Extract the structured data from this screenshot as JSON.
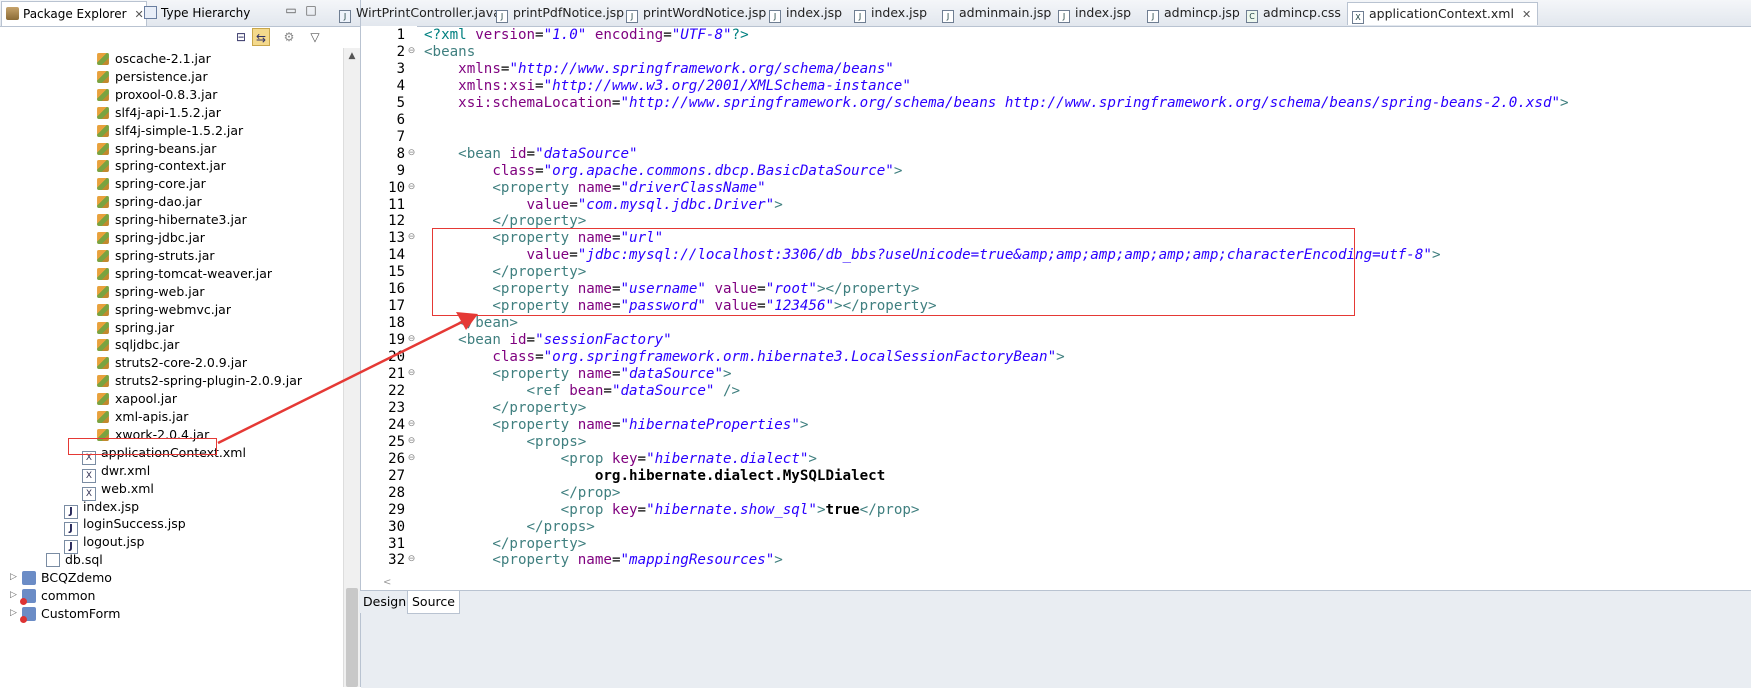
{
  "left_panel": {
    "tabs": [
      {
        "label": "Package Explorer",
        "close": "✕"
      },
      {
        "label": "Type Hierarchy"
      }
    ],
    "tree_items": [
      {
        "label": "oscache-2.1.jar",
        "icon": "jar-icon"
      },
      {
        "label": "persistence.jar",
        "icon": "jar-icon"
      },
      {
        "label": "proxool-0.8.3.jar",
        "icon": "jar-icon"
      },
      {
        "label": "slf4j-api-1.5.2.jar",
        "icon": "jar-icon"
      },
      {
        "label": "slf4j-simple-1.5.2.jar",
        "icon": "jar-icon"
      },
      {
        "label": "spring-beans.jar",
        "icon": "jar-icon"
      },
      {
        "label": "spring-context.jar",
        "icon": "jar-icon"
      },
      {
        "label": "spring-core.jar",
        "icon": "jar-icon"
      },
      {
        "label": "spring-dao.jar",
        "icon": "jar-icon"
      },
      {
        "label": "spring-hibernate3.jar",
        "icon": "jar-icon"
      },
      {
        "label": "spring-jdbc.jar",
        "icon": "jar-icon"
      },
      {
        "label": "spring-struts.jar",
        "icon": "jar-icon"
      },
      {
        "label": "spring-tomcat-weaver.jar",
        "icon": "jar-icon"
      },
      {
        "label": "spring-web.jar",
        "icon": "jar-icon"
      },
      {
        "label": "spring-webmvc.jar",
        "icon": "jar-icon"
      },
      {
        "label": "spring.jar",
        "icon": "jar-icon"
      },
      {
        "label": "sqljdbc.jar",
        "icon": "jar-icon"
      },
      {
        "label": "struts2-core-2.0.9.jar",
        "icon": "jar-icon"
      },
      {
        "label": "struts2-spring-plugin-2.0.9.jar",
        "icon": "jar-icon"
      },
      {
        "label": "xapool.jar",
        "icon": "jar-icon"
      },
      {
        "label": "xml-apis.jar",
        "icon": "jar-icon"
      },
      {
        "label": "xwork-2.0.4.jar",
        "icon": "jar-icon"
      },
      {
        "label": "applicationContext.xml",
        "icon": "xml-file-icon"
      },
      {
        "label": "dwr.xml",
        "icon": "xml-file-icon"
      },
      {
        "label": "web.xml",
        "icon": "xml-file-icon"
      },
      {
        "label": "index.jsp",
        "icon": "jsp-file-icon"
      },
      {
        "label": "loginSuccess.jsp",
        "icon": "jsp-file-icon"
      },
      {
        "label": "logout.jsp",
        "icon": "jsp-file-icon"
      },
      {
        "label": "db.sql",
        "icon": "sql-file-icon"
      },
      {
        "label": "BCQZdemo",
        "icon": "project-icon"
      },
      {
        "label": "common",
        "icon": "project-error-icon"
      },
      {
        "label": "CustomForm",
        "icon": "project-error-icon"
      }
    ]
  },
  "editor": {
    "tabs": [
      {
        "label": "WirtPrintController.java",
        "icon": "java-file-icon"
      },
      {
        "label": "printPdfNotice.jsp",
        "icon": "jsp-file-icon"
      },
      {
        "label": "printWordNotice.jsp",
        "icon": "jsp-file-icon"
      },
      {
        "label": "index.jsp",
        "icon": "jsp-file-icon"
      },
      {
        "label": "index.jsp",
        "icon": "jsp-file-icon"
      },
      {
        "label": "adminmain.jsp",
        "icon": "jsp-file-icon"
      },
      {
        "label": "index.jsp",
        "icon": "jsp-file-icon"
      },
      {
        "label": "admincp.jsp",
        "icon": "jsp-file-icon"
      },
      {
        "label": "admincp.css",
        "icon": "css-file-icon"
      },
      {
        "label": "applicationContext.xml",
        "icon": "xml-file-icon",
        "active": true,
        "close": "✕"
      }
    ],
    "bottom_tabs": {
      "design": "Design",
      "source": "Source"
    },
    "lines": [
      {
        "n": "1",
        "s": [
          [
            "pi",
            "<?xml "
          ],
          [
            "attr",
            "version"
          ],
          [
            "",
            "="
          ],
          [
            "val",
            "\"1.0\""
          ],
          [
            "",
            "",
            " "
          ],
          [
            "attr",
            " encoding"
          ],
          [
            "",
            "="
          ],
          [
            "val",
            "\"UTF-8\""
          ],
          [
            "pi",
            "?>"
          ]
        ]
      },
      {
        "n": "2",
        "f": "⊖",
        "s": [
          [
            "tag",
            "<beans"
          ]
        ]
      },
      {
        "n": "3",
        "s": [
          [
            "",
            "    "
          ],
          [
            "attr",
            "xmlns"
          ],
          [
            "",
            "="
          ],
          [
            "val",
            "\"http://www.springframework.org/schema/beans\""
          ]
        ]
      },
      {
        "n": "4",
        "s": [
          [
            "",
            "    "
          ],
          [
            "attr",
            "xmlns:xsi"
          ],
          [
            "",
            "="
          ],
          [
            "val",
            "\"http://www.w3.org/2001/XMLSchema-instance\""
          ]
        ]
      },
      {
        "n": "5",
        "s": [
          [
            "",
            "    "
          ],
          [
            "attr",
            "xsi:schemaLocation"
          ],
          [
            "",
            "="
          ],
          [
            "val",
            "\"http://www.springframework.org/schema/beans http://www.springframework.org/schema/beans/spring-beans-2.0.xsd\""
          ],
          [
            "tag",
            ">"
          ]
        ]
      },
      {
        "n": "6",
        "s": []
      },
      {
        "n": "7",
        "s": []
      },
      {
        "n": "8",
        "f": "⊖",
        "s": [
          [
            "",
            "    "
          ],
          [
            "tag",
            "<bean "
          ],
          [
            "attr",
            "id"
          ],
          [
            "",
            "="
          ],
          [
            "val",
            "\"dataSource\""
          ]
        ]
      },
      {
        "n": "9",
        "s": [
          [
            "",
            "        "
          ],
          [
            "attr",
            "class"
          ],
          [
            "",
            "="
          ],
          [
            "val",
            "\"org.apache.commons.dbcp.BasicDataSource\""
          ],
          [
            "tag",
            ">"
          ]
        ]
      },
      {
        "n": "10",
        "f": "⊖",
        "s": [
          [
            "",
            "        "
          ],
          [
            "tag",
            "<property "
          ],
          [
            "attr",
            "name"
          ],
          [
            "",
            "="
          ],
          [
            "val",
            "\"driverClassName\""
          ]
        ]
      },
      {
        "n": "11",
        "s": [
          [
            "",
            "            "
          ],
          [
            "attr",
            "value"
          ],
          [
            "",
            "="
          ],
          [
            "val",
            "\"com.mysql.jdbc.Driver\""
          ],
          [
            "tag",
            ">"
          ]
        ]
      },
      {
        "n": "12",
        "s": [
          [
            "",
            "        "
          ],
          [
            "tag",
            "</property>"
          ]
        ]
      },
      {
        "n": "13",
        "f": "⊖",
        "s": [
          [
            "",
            "        "
          ],
          [
            "tag",
            "<property "
          ],
          [
            "attr",
            "name"
          ],
          [
            "",
            "="
          ],
          [
            "val",
            "\"url\""
          ]
        ]
      },
      {
        "n": "14",
        "s": [
          [
            "",
            "            "
          ],
          [
            "attr",
            "value"
          ],
          [
            "",
            "="
          ],
          [
            "val",
            "\"jdbc:mysql://localhost:3306/db_bbs?useUnicode=true&amp;amp;amp;amp;amp;amp;characterEncoding=utf-8\""
          ],
          [
            "tag",
            ">"
          ]
        ]
      },
      {
        "n": "15",
        "s": [
          [
            "",
            "        "
          ],
          [
            "tag",
            "</property>"
          ]
        ]
      },
      {
        "n": "16",
        "s": [
          [
            "",
            "        "
          ],
          [
            "tag",
            "<property "
          ],
          [
            "attr",
            "name"
          ],
          [
            "",
            "="
          ],
          [
            "val",
            "\"username\""
          ],
          [
            "",
            "",
            " "
          ],
          [
            "attr",
            " value"
          ],
          [
            "",
            "="
          ],
          [
            "val",
            "\"root\""
          ],
          [
            "tag",
            "></property>"
          ]
        ]
      },
      {
        "n": "17",
        "s": [
          [
            "",
            "        "
          ],
          [
            "tag",
            "<property "
          ],
          [
            "attr",
            "name"
          ],
          [
            "",
            "="
          ],
          [
            "val",
            "\"password\""
          ],
          [
            "",
            "",
            " "
          ],
          [
            "attr",
            " value"
          ],
          [
            "",
            "="
          ],
          [
            "val",
            "\"123456\""
          ],
          [
            "tag",
            "></property>"
          ]
        ]
      },
      {
        "n": "18",
        "s": [
          [
            "",
            "    "
          ],
          [
            "tag",
            "</bean>"
          ]
        ]
      },
      {
        "n": "19",
        "f": "⊖",
        "s": [
          [
            "",
            "    "
          ],
          [
            "tag",
            "<bean "
          ],
          [
            "attr",
            "id"
          ],
          [
            "",
            "="
          ],
          [
            "val",
            "\"sessionFactory\""
          ]
        ]
      },
      {
        "n": "20",
        "s": [
          [
            "",
            "        "
          ],
          [
            "attr",
            "class"
          ],
          [
            "",
            "="
          ],
          [
            "val",
            "\"org.springframework.orm.hibernate3.LocalSessionFactoryBean\""
          ],
          [
            "tag",
            ">"
          ]
        ]
      },
      {
        "n": "21",
        "f": "⊖",
        "s": [
          [
            "",
            "        "
          ],
          [
            "tag",
            "<property "
          ],
          [
            "attr",
            "name"
          ],
          [
            "",
            "="
          ],
          [
            "val",
            "\"dataSource\""
          ],
          [
            "tag",
            ">"
          ]
        ]
      },
      {
        "n": "22",
        "s": [
          [
            "",
            "            "
          ],
          [
            "tag",
            "<ref "
          ],
          [
            "attr",
            "bean"
          ],
          [
            "",
            "="
          ],
          [
            "val",
            "\"dataSource\""
          ],
          [
            "tag",
            " />"
          ]
        ]
      },
      {
        "n": "23",
        "s": [
          [
            "",
            "        "
          ],
          [
            "tag",
            "</property>"
          ]
        ]
      },
      {
        "n": "24",
        "f": "⊖",
        "s": [
          [
            "",
            "        "
          ],
          [
            "tag",
            "<property "
          ],
          [
            "attr",
            "name"
          ],
          [
            "",
            "="
          ],
          [
            "val",
            "\"hibernateProperties\""
          ],
          [
            "tag",
            ">"
          ]
        ]
      },
      {
        "n": "25",
        "f": "⊖",
        "s": [
          [
            "",
            "            "
          ],
          [
            "tag",
            "<props>"
          ]
        ]
      },
      {
        "n": "26",
        "f": "⊖",
        "s": [
          [
            "",
            "                "
          ],
          [
            "tag",
            "<prop "
          ],
          [
            "attr",
            "key"
          ],
          [
            "",
            "="
          ],
          [
            "val",
            "\"hibernate.dialect\""
          ],
          [
            "tag",
            ">"
          ]
        ]
      },
      {
        "n": "27",
        "s": [
          [
            "",
            "                    "
          ],
          [
            "bold",
            "org.hibernate.dialect.MySQLDialect"
          ]
        ]
      },
      {
        "n": "28",
        "s": [
          [
            "",
            "                "
          ],
          [
            "tag",
            "</prop>"
          ]
        ]
      },
      {
        "n": "29",
        "s": [
          [
            "",
            "                "
          ],
          [
            "tag",
            "<prop "
          ],
          [
            "attr",
            "key"
          ],
          [
            "",
            "="
          ],
          [
            "val",
            "\"hibernate.show_sql\""
          ],
          [
            "tag",
            ">"
          ],
          [
            "bold",
            "true"
          ],
          [
            "tag",
            "</prop>"
          ]
        ]
      },
      {
        "n": "30",
        "s": [
          [
            "",
            "            "
          ],
          [
            "tag",
            "</props>"
          ]
        ]
      },
      {
        "n": "31",
        "s": [
          [
            "",
            "        "
          ],
          [
            "tag",
            "</property>"
          ]
        ]
      },
      {
        "n": "32",
        "f": "⊖",
        "s": [
          [
            "",
            "        "
          ],
          [
            "tag",
            "<property "
          ],
          [
            "attr",
            "name"
          ],
          [
            "",
            "="
          ],
          [
            "val",
            "\"mappingResources\""
          ],
          [
            "tag",
            ">"
          ]
        ]
      }
    ]
  },
  "colors": {
    "highlight_box": "#e53935",
    "xml_tag": "#3f7f7f",
    "xml_attr": "#7f007f",
    "xml_value": "#2a00ff"
  }
}
